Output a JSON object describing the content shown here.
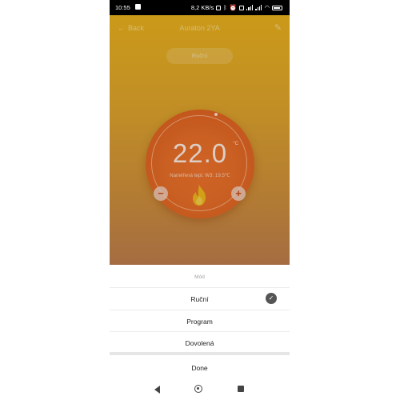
{
  "status_bar": {
    "time": "10:55",
    "network_speed": "8,2 KB/s",
    "battery_level": "85"
  },
  "header": {
    "back_label": "Back",
    "title": "Auraton 2YA",
    "edit_icon": "pencil-icon"
  },
  "mode_pill": {
    "label": "Ruční"
  },
  "thermostat": {
    "set_temperature": "22.0",
    "unit": "°C",
    "measured_label": "Naměřená tepl. W3:",
    "measured_value": "19.5℃",
    "minus_label": "−",
    "plus_label": "+",
    "heating_icon": "flame-icon",
    "colors": {
      "dial": "#e06a26",
      "flame": "#e8b31a"
    }
  },
  "mode_sheet": {
    "title": "Mód",
    "options": [
      {
        "label": "Ruční",
        "selected": true
      },
      {
        "label": "Program",
        "selected": false
      },
      {
        "label": "Dovolená",
        "selected": false
      }
    ],
    "done_label": "Done"
  },
  "nav_bar": {
    "back_icon": "triangle-back-icon",
    "home_icon": "circle-home-icon",
    "recents_icon": "square-recents-icon"
  }
}
